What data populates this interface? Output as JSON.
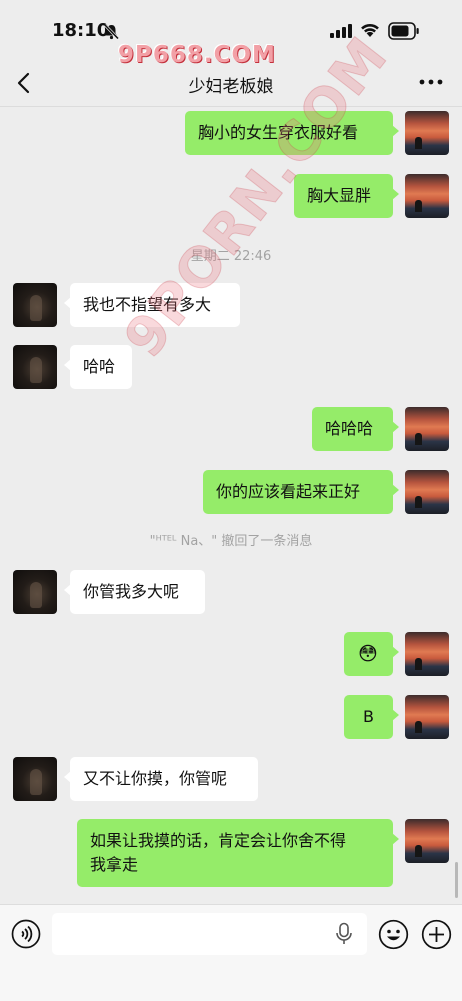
{
  "status_bar": {
    "time": "18:10"
  },
  "watermark": {
    "top_text": "9P668.COM",
    "diagonal_text": "9PORN.COM"
  },
  "header": {
    "title": "少妇老板娘",
    "more_label": "···"
  },
  "messages": [
    {
      "text": "胸小的女生穿衣服好看"
    },
    {
      "text": "胸大显胖"
    },
    {
      "timestamp": "星期二 22:46"
    },
    {
      "text": "我也不指望有多大"
    },
    {
      "text": "哈哈"
    },
    {
      "text": "哈哈哈"
    },
    {
      "text": "你的应该看起来正好"
    },
    {
      "system": "\"ᴴᵀᴱᴸ Na、\" 撤回了一条消息"
    },
    {
      "text": "你管我多大呢"
    },
    {
      "text": "😳"
    },
    {
      "text": "B"
    },
    {
      "text": "又不让你摸，你管呢"
    },
    {
      "text_line1": "如果让我摸的话，肯定会让你舍不得",
      "text_line2": "我拿走"
    }
  ],
  "input": {
    "value": ""
  }
}
